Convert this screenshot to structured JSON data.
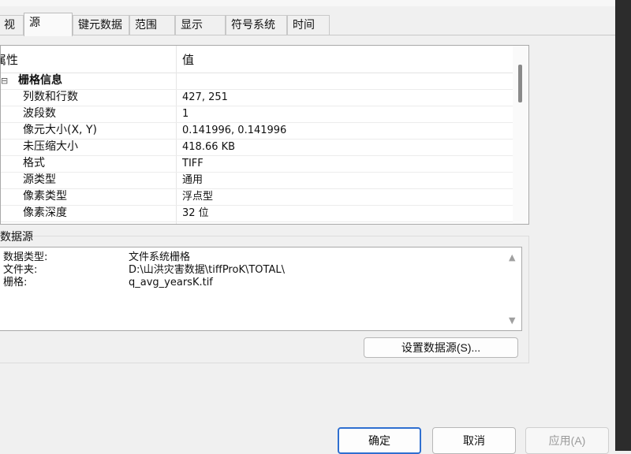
{
  "tabs": [
    "视",
    "源",
    "键元数据",
    "范围",
    "显示",
    "符号系统",
    "时间"
  ],
  "property_grid": {
    "header_property": "属性",
    "header_value": "值",
    "expander": "⊟",
    "group_label": "栅格信息",
    "rows": [
      {
        "key": "列数和行数",
        "value": "427, 251"
      },
      {
        "key": "波段数",
        "value": "1"
      },
      {
        "key": "像元大小(X, Y)",
        "value": "0.141996, 0.141996"
      },
      {
        "key": "未压缩大小",
        "value": "418.66 KB"
      },
      {
        "key": "格式",
        "value": "TIFF"
      },
      {
        "key": "源类型",
        "value": "通用"
      },
      {
        "key": "像素类型",
        "value": "浮点型"
      },
      {
        "key": "像素深度",
        "value": "32 位"
      }
    ]
  },
  "data_source": {
    "title": "数据源",
    "lines": [
      {
        "label": "数据类型:",
        "value": "文件系统栅格"
      },
      {
        "label": "文件夹:",
        "value": "D:\\山洪灾害数据\\tiffProK\\TOTAL\\"
      },
      {
        "label": "栅格:",
        "value": "q_avg_yearsK.tif"
      }
    ],
    "scroll_up": "▲",
    "scroll_down": "▼",
    "set_button": "设置数据源(S)..."
  },
  "buttons": {
    "ok": "确定",
    "cancel": "取消",
    "apply": "应用(A)"
  }
}
